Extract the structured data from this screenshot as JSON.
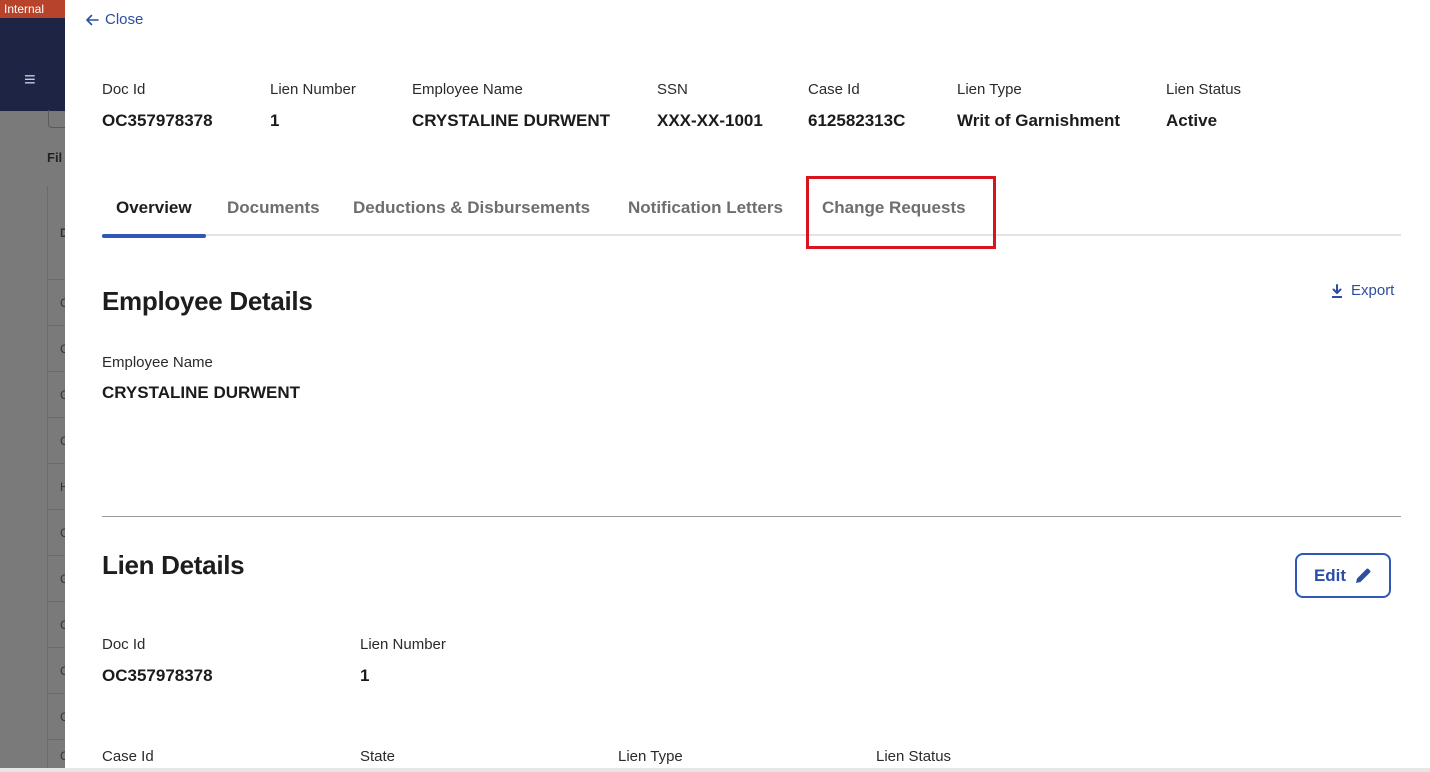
{
  "background": {
    "env_label": "Internal",
    "filter_label": "Fil",
    "row_letters": [
      "D",
      "C",
      "C",
      "C",
      "C",
      "H",
      "C",
      "C",
      "C",
      "C",
      "C",
      "C"
    ]
  },
  "modal": {
    "close_label": "Close",
    "summary": [
      {
        "label": "Doc Id",
        "value": "OC357978378"
      },
      {
        "label": "Lien Number",
        "value": "1"
      },
      {
        "label": "Employee Name",
        "value": "CRYSTALINE DURWENT"
      },
      {
        "label": "SSN",
        "value": "XXX-XX-1001"
      },
      {
        "label": "Case Id",
        "value": "612582313C"
      },
      {
        "label": "Lien Type",
        "value": "Writ of Garnishment"
      },
      {
        "label": "Lien Status",
        "value": "Active"
      }
    ],
    "tabs": [
      {
        "label": "Overview",
        "active": true
      },
      {
        "label": "Documents",
        "active": false
      },
      {
        "label": "Deductions & Disbursements",
        "active": false
      },
      {
        "label": "Notification Letters",
        "active": false
      },
      {
        "label": "Change Requests",
        "active": false
      }
    ],
    "employee_details": {
      "title": "Employee Details",
      "export_label": "Export",
      "employee_name_label": "Employee Name",
      "employee_name_value": "CRYSTALINE DURWENT"
    },
    "lien_details": {
      "title": "Lien Details",
      "edit_label": "Edit",
      "doc_id_label": "Doc Id",
      "doc_id_value": "OC357978378",
      "lien_number_label": "Lien Number",
      "lien_number_value": "1",
      "case_id_label": "Case Id",
      "state_label": "State",
      "lien_type_label": "Lien Type",
      "lien_status_label": "Lien Status"
    }
  },
  "colors": {
    "accent": "#2f57b8",
    "link": "#2b4ea2",
    "highlight": "#d8141c",
    "env_banner": "#b8432b",
    "header_bg": "#1e2544"
  }
}
